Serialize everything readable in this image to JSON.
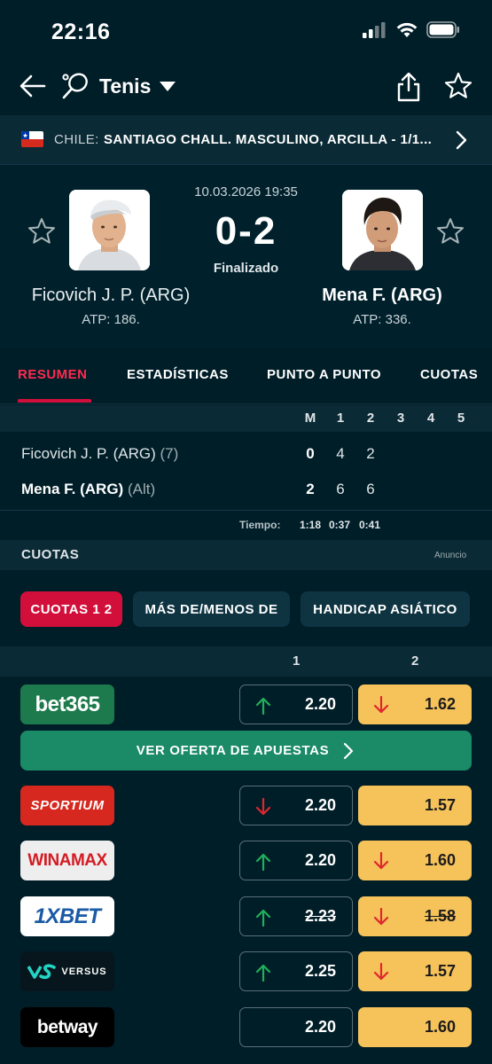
{
  "status_bar": {
    "time": "22:16"
  },
  "header": {
    "title": "Tenis"
  },
  "tournament": {
    "prefix": "CHILE:",
    "name": "SANTIAGO CHALL. MASCULINO, ARCILLA - 1/1..."
  },
  "match": {
    "datetime": "10.03.2026 19:35",
    "score": "0-2",
    "status": "Finalizado",
    "player1": {
      "name": "Ficovich J. P. (ARG)",
      "rank": "ATP: 186."
    },
    "player2": {
      "name": "Mena F. (ARG)",
      "rank": "ATP: 336."
    }
  },
  "tabs": [
    {
      "label": "RESUMEN",
      "active": true
    },
    {
      "label": "ESTADÍSTICAS"
    },
    {
      "label": "PUNTO A PUNTO"
    },
    {
      "label": "CUOTAS"
    }
  ],
  "score_table": {
    "columns": [
      "M",
      "1",
      "2",
      "3",
      "4",
      "5"
    ],
    "rows": [
      {
        "name": "Ficovich J. P. (ARG)",
        "suffix": "(7)",
        "values": [
          "0",
          "4",
          "2"
        ]
      },
      {
        "name": "Mena F. (ARG)",
        "suffix": "(Alt)",
        "values": [
          "2",
          "6",
          "6"
        ]
      }
    ],
    "time_label": "Tiempo:",
    "times": [
      "1:18",
      "0:37",
      "0:41"
    ]
  },
  "odds": {
    "title": "CUOTAS",
    "ad_label": "Anuncio",
    "chips": [
      "CUOTAS 1 2",
      "MÁS DE/MENOS DE",
      "HANDICAP ASIÁTICO"
    ],
    "col1": "1",
    "col2": "2",
    "offer_button": "VER OFERTA DE APUESTAS",
    "colors": {
      "up": "#1fb15a",
      "down": "#e0262f",
      "highlight": "#f6c25a"
    },
    "bookmakers": [
      {
        "name": "bet365",
        "odd1": "2.20",
        "dir1": "up",
        "odd2": "1.62",
        "dir2": "down"
      },
      {
        "name": "SPORTIUM",
        "odd1": "2.20",
        "dir1": "down",
        "odd2": "1.57",
        "dir2": ""
      },
      {
        "name": "WINAMAX",
        "odd1": "2.20",
        "dir1": "up",
        "odd2": "1.60",
        "dir2": "down"
      },
      {
        "name": "1XBET",
        "odd1": "2.23",
        "dir1": "up",
        "odd2": "1.58",
        "dir2": "down",
        "struck": true
      },
      {
        "name": "VERSUS",
        "odd1": "2.25",
        "dir1": "up",
        "odd2": "1.57",
        "dir2": "down"
      },
      {
        "name": "betway",
        "odd1": "2.20",
        "dir1": "",
        "odd2": "1.60",
        "dir2": ""
      }
    ]
  }
}
